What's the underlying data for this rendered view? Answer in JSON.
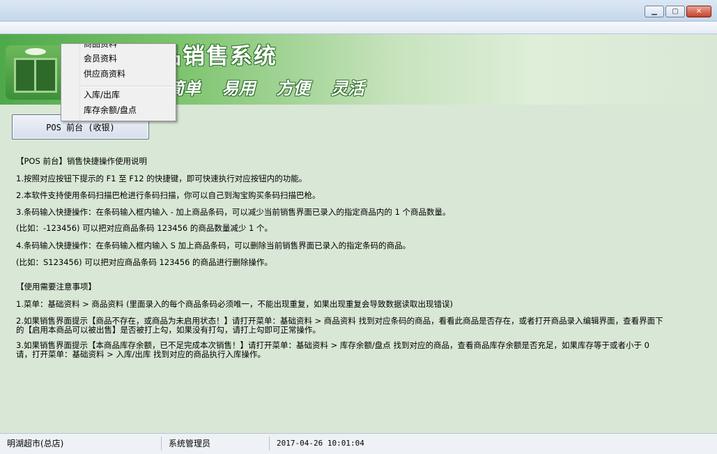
{
  "window": {
    "minimize_glyph": "▁",
    "maximize_glyph": "▢",
    "close_glyph": "✕"
  },
  "banner": {
    "title": "品销售系统",
    "slogan": [
      "简单",
      "易用",
      "方便",
      "灵活"
    ]
  },
  "menu": {
    "items": [
      {
        "label": "商品资料"
      },
      {
        "label": "会员资料"
      },
      {
        "label": "供应商资料"
      },
      {
        "label": "入库/出库"
      },
      {
        "label": "库存余额/盘点"
      }
    ]
  },
  "pos_button": {
    "label": "POS 前台 (收银)"
  },
  "instructions": {
    "heading1": "【POS 前台】销售快捷操作使用说明",
    "lines1": [
      "1.按照对应按钮下提示的 F1 至 F12 的快捷键，即可快速执行对应按钮内的功能。",
      "2.本软件支持使用条码扫描巴枪进行条码扫描，你可以自己到淘宝购买条码扫描巴枪。",
      "3.条码输入快捷操作：在条码输入框内输入 - 加上商品条码，可以减少当前销售界面已录入的指定商品内的 1 个商品数量。",
      "(比如：-123456) 可以把对应商品条码 123456 的商品数量减少 1 个。",
      "4.条码输入快捷操作：在条码输入框内输入 S 加上商品条码，可以删除当前销售界面已录入的指定条码的商品。",
      "(比如：S123456) 可以把对应商品条码 123456 的商品进行删除操作。"
    ],
    "heading2": "【使用需要注意事项】",
    "lines2": [
      "1.菜单：基础资料 > 商品资料 (里面录入的每个商品条码必须唯一，不能出现重复，如果出现重复会导致数据读取出现错误)",
      "2.如果销售界面提示【商品不存在，或商品为未启用状态！】请打开菜单：基础资料 > 商品资料 找到对应条码的商品，看看此商品是否存在，或者打开商品录入编辑界面，查看界面下的【启用本商品可以被出售】是否被打上勾，如果没有打勾，请打上勾即可正常操作。",
      "3.如果销售界面提示【本商品库存余额，已不足完成本次销售！】请打开菜单：基础资料 > 库存余额/盘点 找到对应的商品，查看商品库存余额是否充足，如果库存等于或者小于 0 请，打开菜单：基础资料 > 入库/出库 找到对应的商品执行入库操作。"
    ]
  },
  "status": {
    "store": "明湖超市(总店)",
    "user": "系统管理员",
    "datetime": "2017-04-26 10:01:04"
  }
}
